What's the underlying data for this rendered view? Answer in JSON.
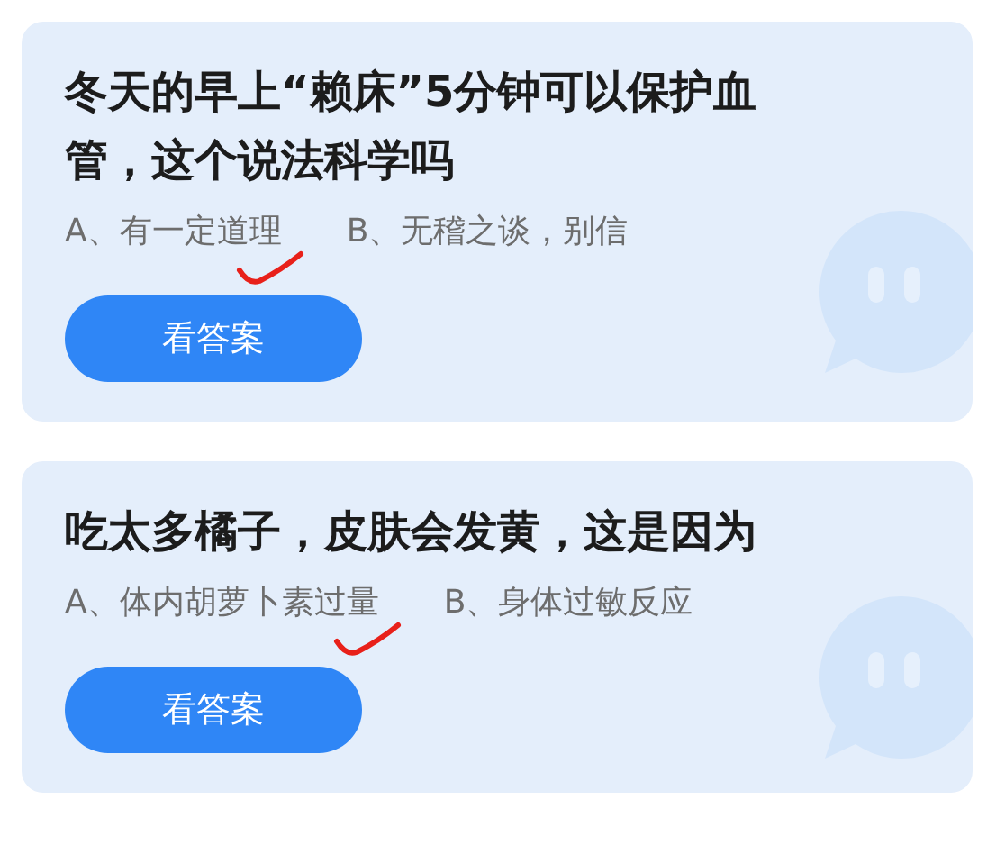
{
  "cards": [
    {
      "question": "冬天的早上“赖床”5分钟可以保护血管，这个说法科学吗",
      "options": [
        {
          "text": "A、有一定道理",
          "marked": true
        },
        {
          "text": "B、无稽之谈，别信",
          "marked": false
        }
      ],
      "button": "看答案"
    },
    {
      "question": "吃太多橘子，皮肤会发黄，这是因为",
      "options": [
        {
          "text": "A、体内胡萝卜素过量",
          "marked": true
        },
        {
          "text": "B、身体过敏反应",
          "marked": false
        }
      ],
      "button": "看答案"
    }
  ]
}
